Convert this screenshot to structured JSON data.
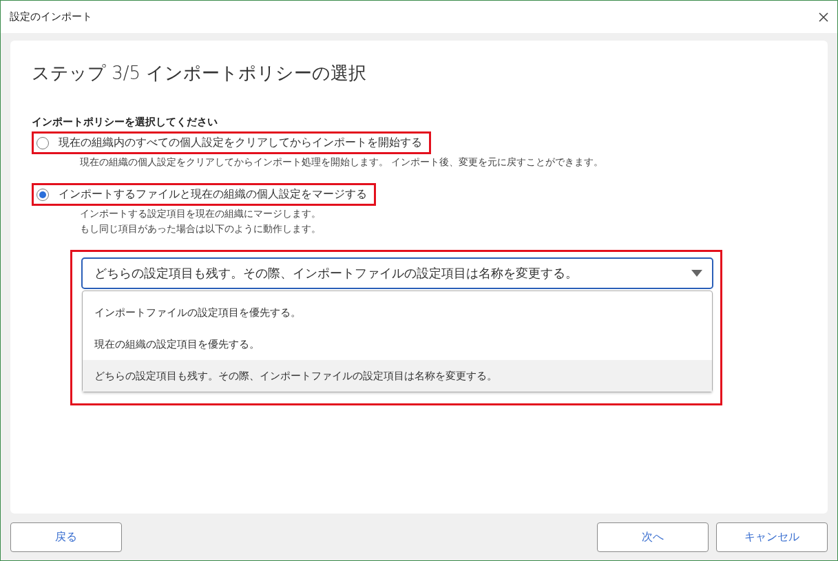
{
  "window": {
    "title": "設定のインポート"
  },
  "step_title": "ステップ 3/5 インポートポリシーの選択",
  "section_label": "インポートポリシーを選択してください",
  "options": [
    {
      "label": "現在の組織内のすべての個人設定をクリアしてからインポートを開始する",
      "selected": false,
      "highlighted": true,
      "description": [
        "現在の組織の個人設定をクリアしてからインポート処理を開始します。 インポート後、変更を元に戻すことができます。"
      ]
    },
    {
      "label": "インポートするファイルと現在の組織の個人設定をマージする",
      "selected": true,
      "highlighted": true,
      "description": [
        "インポートする設定項目を現在の組織にマージします。",
        "もし同じ項目があった場合は以下のように動作します。"
      ]
    }
  ],
  "dropdown": {
    "value": "どちらの設定項目も残す。その際、インポートファイルの設定項目は名称を変更する。",
    "expanded": true,
    "highlighted": true,
    "items": [
      {
        "label": "インポートファイルの設定項目を優先する。",
        "selected": false
      },
      {
        "label": "現在の組織の設定項目を優先する。",
        "selected": false
      },
      {
        "label": "どちらの設定項目も残す。その際、インポートファイルの設定項目は名称を変更する。",
        "selected": true
      }
    ]
  },
  "buttons": {
    "back": "戻る",
    "next": "次へ",
    "cancel": "キャンセル"
  }
}
